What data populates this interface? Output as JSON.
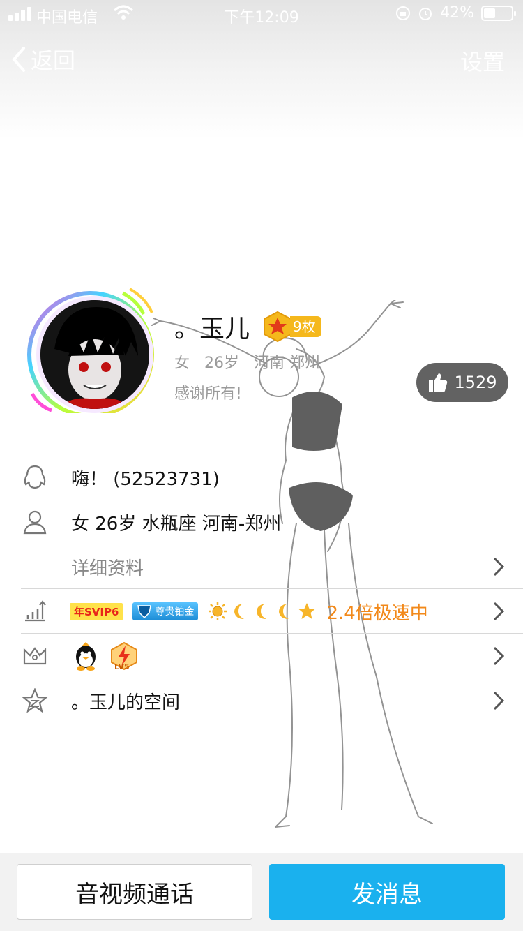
{
  "status_bar": {
    "carrier": "中国电信",
    "time": "下午12:09",
    "battery_text": "42%",
    "battery_level": 0.42
  },
  "nav": {
    "back_label": "返回",
    "settings_label": "设置"
  },
  "profile": {
    "name": "。玉儿",
    "medal_count": "9枚",
    "gender": "女",
    "age": "26岁",
    "location": "河南 郑州",
    "signature": "感谢所有!",
    "likes": "1529"
  },
  "list": {
    "qq_row": "嗨！ (52523731)",
    "info_row": "女 26岁 水瓶座 河南-郑州",
    "detail_label": "详细资料",
    "vip": {
      "svip_badge": "年SVIP6",
      "platinum_badge": "尊贵铂金",
      "level_icons": [
        "sun-icon",
        "moon-icon",
        "moon-icon",
        "moon-icon",
        "star-icon"
      ],
      "speed_text": "2.4倍极速中"
    },
    "privilege_icons": [
      "qq-penguin-icon",
      "lightning-lv5-icon"
    ],
    "privilege_badge_text": "LV5",
    "space_label": "。玉儿的空间"
  },
  "bottom_bar": {
    "call_label": "音视频通话",
    "message_label": "发消息"
  },
  "colors": {
    "accent_blue": "#1ab1ee",
    "speed_orange": "#f2891a",
    "like_bg": "#464646"
  }
}
